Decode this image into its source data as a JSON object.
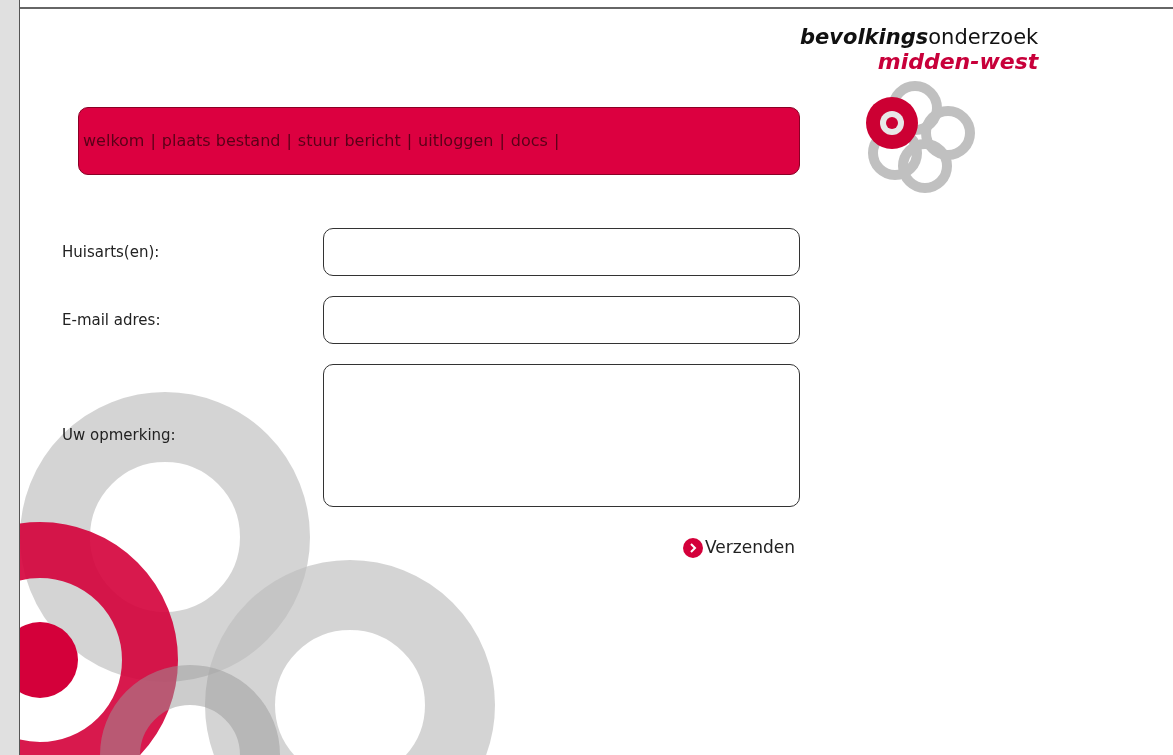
{
  "nav": {
    "separator": "|",
    "items": [
      {
        "label": "welkom"
      },
      {
        "label": "plaats bestand"
      },
      {
        "label": "stuur bericht"
      },
      {
        "label": "uitloggen"
      },
      {
        "label": "docs"
      }
    ]
  },
  "logo": {
    "line1": "**bevolkings**onderzoek",
    "line2": "midden-west"
  },
  "form": {
    "fields": [
      {
        "label": "Huisarts(en):",
        "kind": "input"
      },
      {
        "label": "E-mail adres:",
        "kind": "input"
      },
      {
        "label": "Uw opmerking:",
        "kind": "textarea"
      }
    ],
    "submit": "Verzenden"
  }
}
